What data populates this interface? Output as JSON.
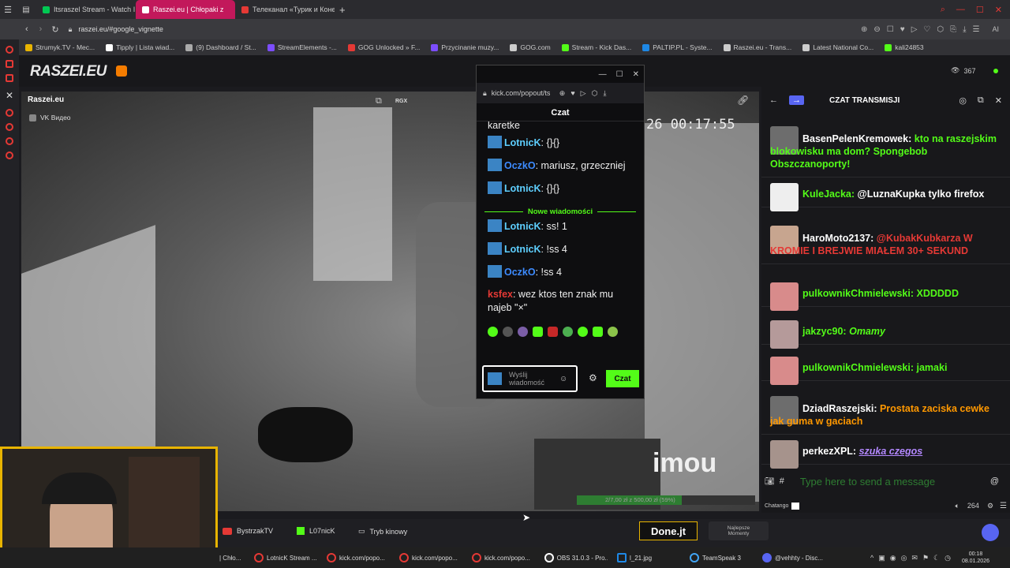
{
  "browser": {
    "tabs": [
      {
        "label": "Itsraszel Stream - Watch I",
        "color": "#00c853"
      },
      {
        "label": "Raszei.eu | Chłopaki z",
        "color": "#ffffff",
        "active": true
      },
      {
        "label": "Телеканал «Турик и Коне",
        "color": "#e53935"
      }
    ],
    "url": "raszei.eu/#google_vignette",
    "bookmarks": [
      {
        "label": "Strumyk.TV - Mec...",
        "color": "#e8b400"
      },
      {
        "label": "Tipply | Lista wiad...",
        "color": "#ffffff"
      },
      {
        "label": "(9) Dashboard / St...",
        "color": "#aaaaaa"
      },
      {
        "label": "StreamElements -...",
        "color": "#7c4dff"
      },
      {
        "label": "GOG Unlocked » F...",
        "color": "#e53935"
      },
      {
        "label": "Przycinanie muzy...",
        "color": "#7c4dff"
      },
      {
        "label": "GOG.com",
        "color": "#cccccc"
      },
      {
        "label": "Stream - Kick Das...",
        "color": "#53fc18"
      },
      {
        "label": "PALTIP.PL - Syste...",
        "color": "#1e88e5"
      },
      {
        "label": "Raszei.eu - Trans...",
        "color": "#cccccc"
      },
      {
        "label": "Latest National Co...",
        "color": "#cccccc"
      },
      {
        "label": "kali24853",
        "color": "#53fc18"
      }
    ]
  },
  "site": {
    "logo": "RASZEI.EU",
    "viewers": "367",
    "channel_title": "Raszei.eu",
    "vk_label": "VK Видео",
    "rgx": "RGX",
    "timestamp": "26 00:17:55",
    "watermark": "imou",
    "progress_text": "2/7,00 zł z 500,00 zł (59%)",
    "progress_fraction": 0.59
  },
  "popup": {
    "url": "kick.com/popout/ts",
    "title": "Czat",
    "cut_text": "karetke",
    "messages_before": [
      {
        "user": "LotnicK",
        "text": ": {}{}",
        "color": "#5ecfff"
      },
      {
        "user": "OczkO",
        "text": ": mariusz, grzeczniej",
        "color": "#3d8bff"
      },
      {
        "user": "LotnicK",
        "text": ": {}{}",
        "color": "#5ecfff"
      }
    ],
    "new_label": "Nowe wiadomości",
    "messages_after": [
      {
        "user": "LotnicK",
        "text": ": ss! 1",
        "color": "#5ecfff"
      },
      {
        "user": "LotnicK",
        "text": ": !ss 4",
        "color": "#5ecfff"
      },
      {
        "user": "OczkO",
        "text": ": !ss 4",
        "color": "#3d8bff"
      },
      {
        "user": "ksfex",
        "text": ": wez ktos ten znak mu najeb \"×\"",
        "color": "#e53935"
      }
    ],
    "input_placeholder": "Wyślij wiadomość",
    "send_label": "Czat"
  },
  "chat": {
    "title": "CZAT TRANSMISJI",
    "messages": [
      {
        "user": "BasenPelenKremowek:",
        "text": "kto na raszejskim blokowisku ma dom? Spongebob Obszczanoporty!",
        "ucolor": "#ffffff",
        "tcolor": "#53fc18"
      },
      {
        "user": "KuleJacka:",
        "text": "@LuznaKupka tylko firefox",
        "ucolor": "#53fc18",
        "tcolor": "#ffffff"
      },
      {
        "user": "HaroMoto2137:",
        "text": "@KubakKubkarza W KROMIE I BREJWIE MIAŁEM 30+ SEKUND",
        "ucolor": "#ffffff",
        "tcolor": "#e53935"
      },
      {
        "user": "pulkownikChmielewski:",
        "text": "XDDDDD",
        "ucolor": "#53fc18",
        "tcolor": "#53fc18"
      },
      {
        "user": "jakzyc90:",
        "text": "Omamy",
        "ucolor": "#53fc18",
        "tcolor": "#53fc18"
      },
      {
        "user": "pulkownikChmielewski:",
        "text": "jamaki",
        "ucolor": "#53fc18",
        "tcolor": "#53fc18"
      },
      {
        "user": "DziadRaszejski:",
        "text": "Prostata zaciska cewke jak guma w gaciach",
        "ucolor": "#ffffff",
        "tcolor": "#ff9800"
      },
      {
        "user": "perkezXPL:",
        "text": "szuka czegos",
        "ucolor": "#ffffff",
        "tcolor": "#b388ff"
      }
    ],
    "input_placeholder": "Type here to send a message",
    "chatango": "Chatango",
    "volume": "264"
  },
  "bottom": {
    "items": [
      "BystrzakTV",
      "L07nicK",
      "Tryb kinowy"
    ],
    "donejt": "Done.jt",
    "newest": "Najlepsze Momenty"
  },
  "taskbar": {
    "items": [
      "| Chło...",
      "LotnicK Stream ...",
      "kick.com/popo...",
      "kick.com/popo...",
      "kick.com/popo...",
      "OBS 31.0.3 - Pro...",
      "l_21.jpg",
      "TeamSpeak 3",
      "@vehhty - Disc..."
    ],
    "time": "00:18",
    "date": "08.01.2026"
  }
}
